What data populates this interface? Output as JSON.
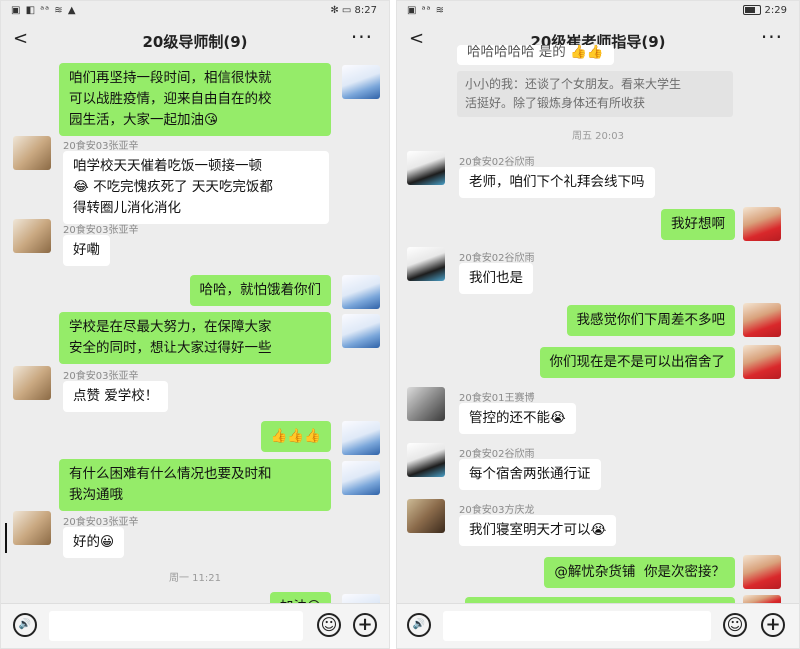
{
  "left": {
    "status_left": "▣ ◧ ᵃᵃ ≋ ▲",
    "status_right": "✻ ▭ 8:27",
    "back": "<",
    "title": "20级导师制(9)",
    "more": "···",
    "messages": [
      {
        "text": "咱们再坚持一段时间，相信很快就\n可以战胜疫情，迎来自由自在的校\n园生活，大家一起加油😘"
      },
      {
        "sender": "20食安03张亚辛",
        "text": "咱学校天天催着吃饭一顿接一顿\n😂 不吃完愧疚死了 天天吃完饭都\n得转圈儿消化消化"
      },
      {
        "sender": "20食安03张亚辛",
        "text": "好嘞"
      },
      {
        "text": "哈哈，就怕饿着你们"
      },
      {
        "text": "学校是在尽最大努力，在保障大家\n安全的同时，想让大家过得好一些"
      },
      {
        "sender": "20食安03张亚辛",
        "text": "点赞 爱学校！"
      },
      {
        "text": "👍👍👍"
      },
      {
        "text": "有什么困难有什么情况也要及时和\n我沟通哦"
      },
      {
        "sender": "20食安03张亚辛",
        "text": "好的😀"
      },
      {
        "text": "加油😘"
      }
    ],
    "timestamp": "周一 11:21"
  },
  "right": {
    "status_left": "▣ ᵃᵃ ≋",
    "status_right": "2:29",
    "back": "<",
    "title": "20级崔老师指导(9)",
    "more": "···",
    "quote_top": "哈哈哈哈哈 是的 👍👍",
    "quote": "小小的我：还谈了个女朋友。看来大学生\n活挺好。除了锻炼身体还有所收获",
    "timestamp": "周五 20:03",
    "messages": [
      {
        "sender": "20食安02谷欣雨",
        "text": "老师，咱们下个礼拜会线下吗"
      },
      {
        "text": "我好想啊"
      },
      {
        "sender": "20食安02谷欣雨",
        "text": "我们也是"
      },
      {
        "text": "我感觉你们下周差不多吧"
      },
      {
        "text": "你们现在是不是可以出宿舍了"
      },
      {
        "sender": "20食安01王赛博",
        "text": "管控的还不能😭"
      },
      {
        "sender": "20食安02谷欣雨",
        "text": "每个宿舍两张通行证"
      },
      {
        "sender": "20食安03方庆龙",
        "text": "我们寝室明天才可以😭"
      },
      {
        "text": "@解忧杂货铺  你是次密接？"
      }
    ]
  },
  "icons": {
    "voice": "🔊",
    "emoji": "☺",
    "plus": "+"
  }
}
